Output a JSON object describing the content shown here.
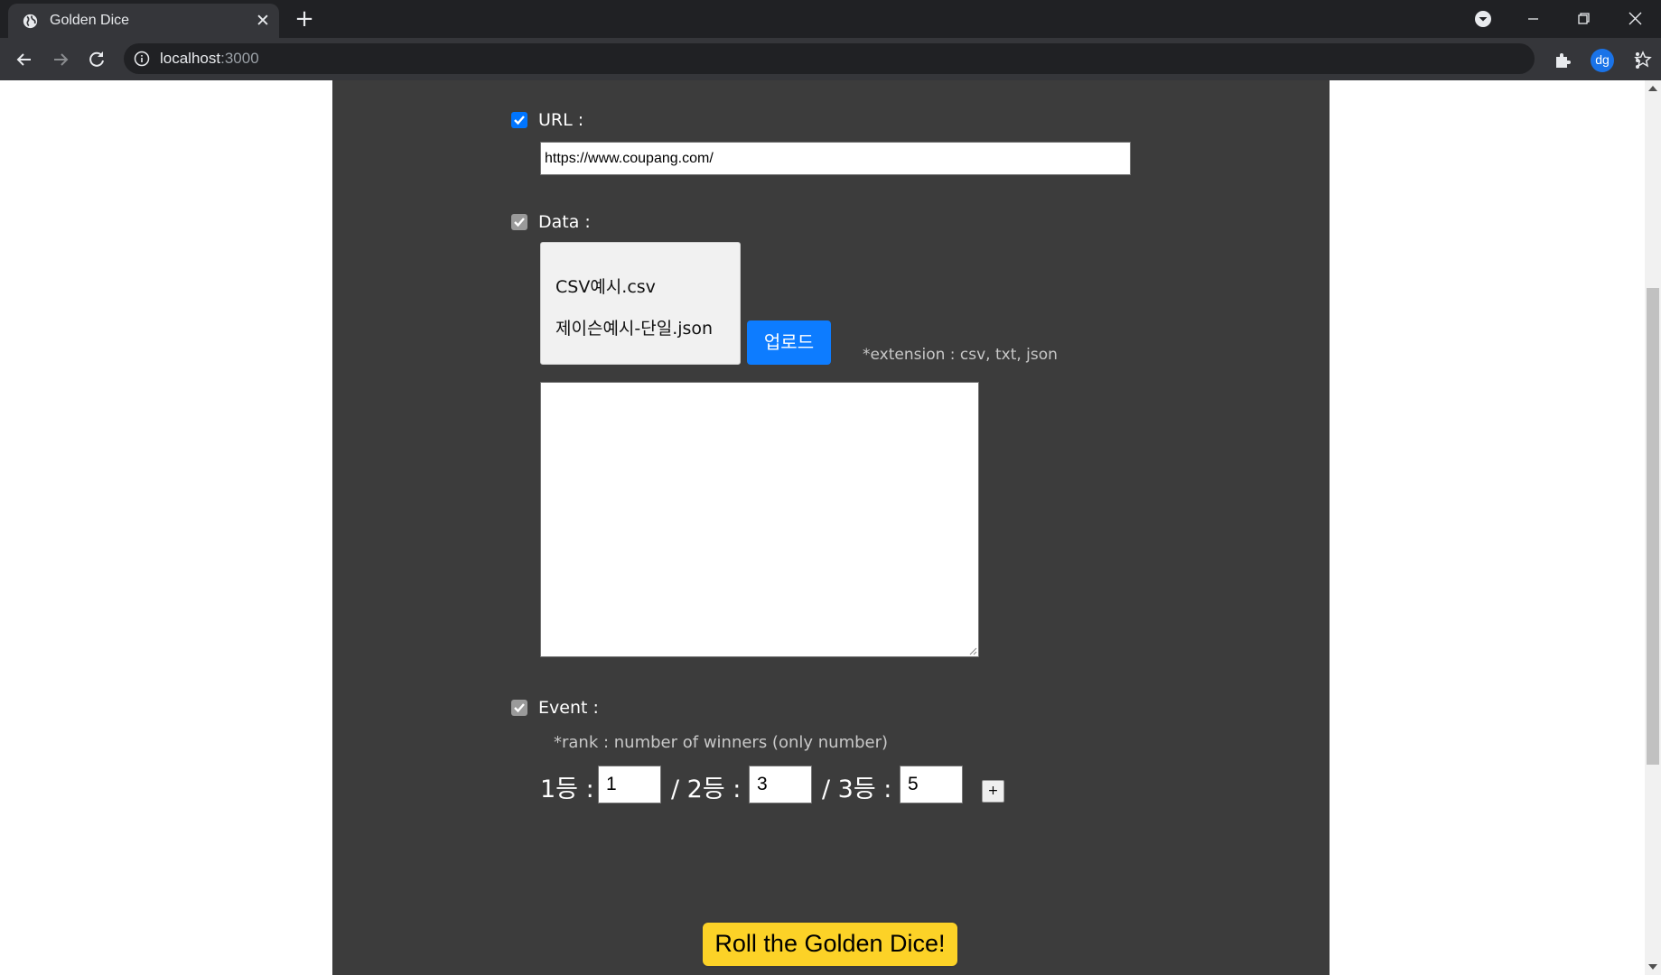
{
  "browser": {
    "tab_title": "Golden Dice",
    "url_host": "localhost",
    "url_port": ":3000",
    "avatar_initials": "dg"
  },
  "form": {
    "url_section": {
      "label": "URL :",
      "checked": true,
      "value": "https://www.coupang.com/"
    },
    "data_section": {
      "label": "Data :",
      "checked": true,
      "files": [
        "CSV예시.csv",
        "제이슨예시-단일.json"
      ],
      "upload_label": "업로드",
      "extension_note": "*extension : csv, txt, json",
      "textarea_value": ""
    },
    "event_section": {
      "label": "Event :",
      "checked": true,
      "rank_note": "*rank : number of winners (only number)",
      "ranks": [
        {
          "label": "1등 :",
          "value": "1"
        },
        {
          "label": "/ 2등 :",
          "value": "3"
        },
        {
          "label": "/ 3등 :",
          "value": "5"
        }
      ],
      "add_label": "+"
    },
    "roll_label": "Roll the Golden Dice!"
  },
  "colors": {
    "panel": "#3c3c3c",
    "primary_blue": "#0d7cff",
    "roll_yellow": "#fcd227"
  }
}
